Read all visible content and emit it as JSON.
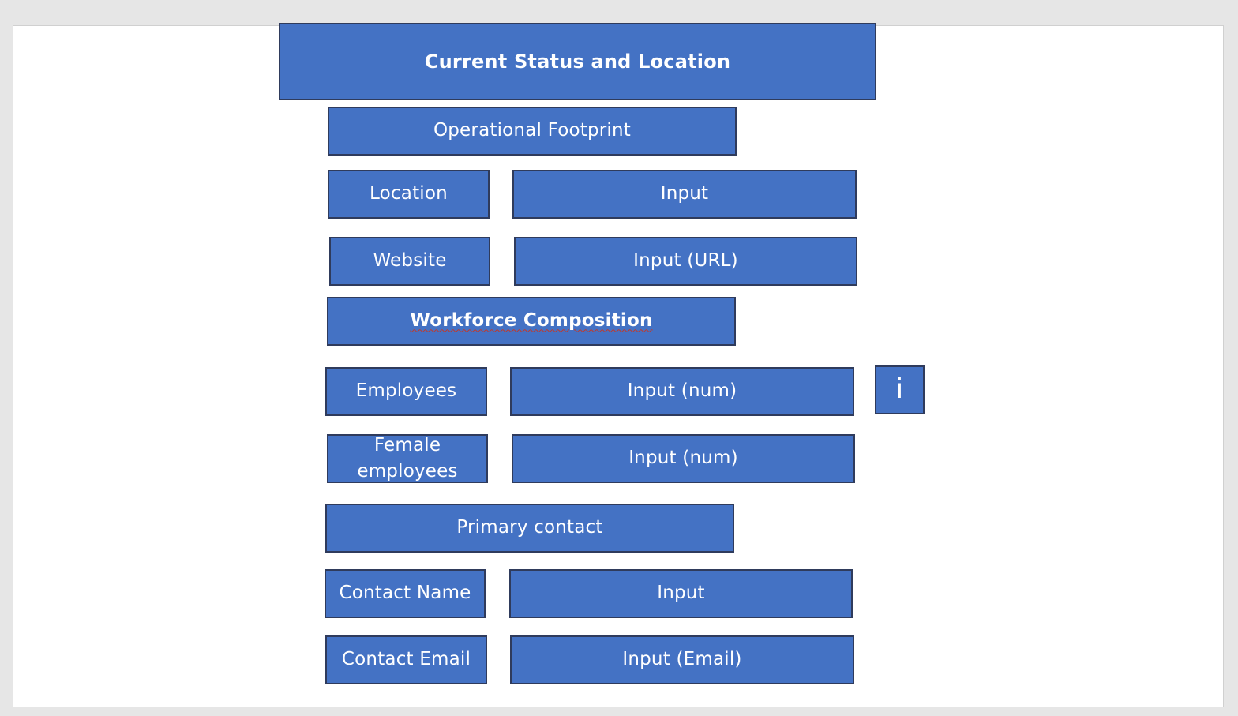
{
  "diagram": {
    "title": "Current Status and Location",
    "sections": {
      "operational_footprint": "Operational Footprint",
      "workforce_composition": "Workforce Composition",
      "primary_contact": "Primary contact"
    },
    "rows": {
      "location": {
        "label": "Location",
        "input": "Input"
      },
      "website": {
        "label": "Website",
        "input": "Input (URL)"
      },
      "employees": {
        "label": "Employees",
        "input": "Input (num)"
      },
      "female_employees": {
        "label": "Female employees",
        "input": "Input (num)"
      },
      "contact_name": {
        "label": "Contact Name",
        "input": "Input"
      },
      "contact_email": {
        "label": "Contact Email",
        "input": "Input (Email)"
      }
    },
    "info_button": "i"
  },
  "colors": {
    "box_fill": "#4472c4",
    "box_border": "#2f3b5c",
    "text": "#ffffff",
    "canvas": "#ffffff",
    "background": "#e6e6e6"
  }
}
